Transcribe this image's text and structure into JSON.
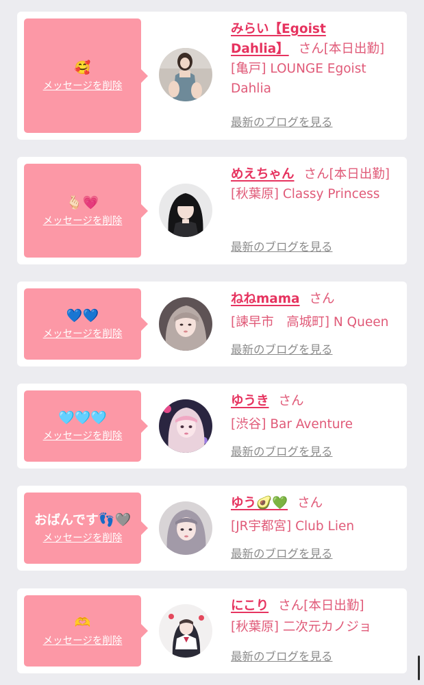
{
  "colors": {
    "bubble": "#fc98a6",
    "name": "#e6335f",
    "store": "#e05a78",
    "blog_link": "#8b8b8b",
    "page_bg": "#ececf0"
  },
  "delete_label": "メッセージを削除",
  "blog_label": "最新のブログを見る",
  "san_label": "さん",
  "cards": [
    {
      "message": "🥰",
      "avatar": "avatar-photo-woman-sitting",
      "name_line1": "みらい【Egoist",
      "name_line2": "Dahlia】",
      "status": "[本日出勤]",
      "store": "[亀戸] LOUNGE Egoist Dahlia"
    },
    {
      "message": "🫰🏻💗",
      "avatar": "avatar-photo-woman-black-hair",
      "name": "めえちゃん",
      "status": "[本日出勤]",
      "store": "[秋葉原] Classy Princess"
    },
    {
      "message": "💙💙",
      "avatar": "avatar-photo-woman-selfie",
      "name": "ねねmama",
      "status": "",
      "store": "[諫早市　高城町] N Queen"
    },
    {
      "message": "🩵🩵🩵",
      "avatar": "avatar-photo-woman-pink-bangs",
      "name": "ゆうき",
      "status": "",
      "store": "[渋谷] Bar Aventure"
    },
    {
      "message": "おばんです👣🩶",
      "avatar": "avatar-photo-woman-long-hair",
      "name": "ゆう🥑💚",
      "status": "",
      "store": "[JR宇都宮] Club Lien"
    },
    {
      "message": "🫶",
      "avatar": "avatar-photo-woman-uniform",
      "name": "にこり",
      "status": "[本日出勤]",
      "store": "[秋葉原] 二次元カノジョ"
    }
  ]
}
